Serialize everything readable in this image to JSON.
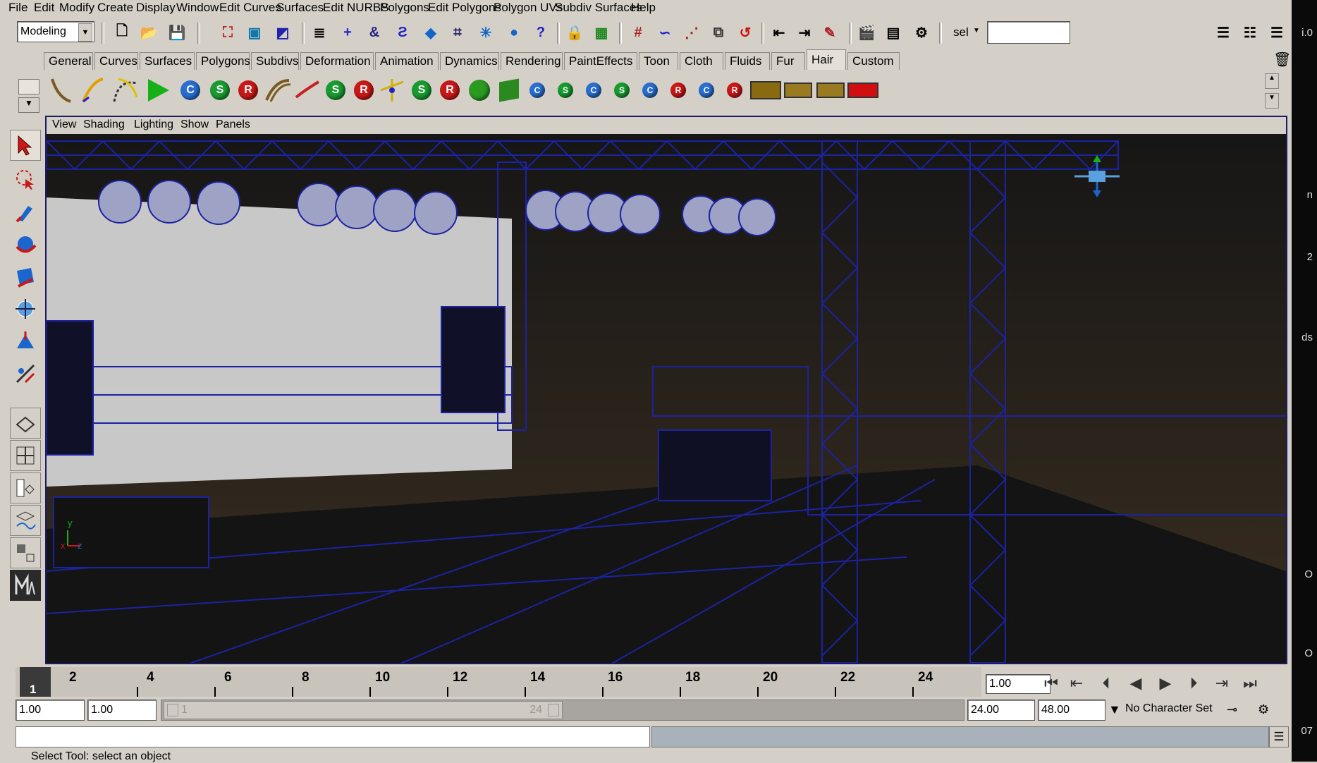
{
  "menu": [
    "File",
    "Edit",
    "Modify",
    "Create",
    "Display",
    "Window",
    "Edit Curves",
    "Surfaces",
    "Edit NURBS",
    "Polygons",
    "Edit Polygons",
    "Polygon UVs",
    "Subdiv Surfaces",
    "Help"
  ],
  "status_line": {
    "mode_select": "Modeling",
    "selection_label": "sel",
    "selection_field": ""
  },
  "shelf_tabs": [
    "General",
    "Curves",
    "Surfaces",
    "Polygons",
    "Subdivs",
    "Deformation",
    "Animation",
    "Dynamics",
    "Rendering",
    "PaintEffects",
    "Toon",
    "Cloth",
    "Fluids",
    "Fur",
    "Hair",
    "Custom"
  ],
  "active_shelf": "Hair",
  "panel_menu": [
    "View",
    "Shading",
    "Lighting",
    "Show",
    "Panels"
  ],
  "timeline": {
    "current_frame_marker": "1",
    "tick_labels": [
      "2",
      "4",
      "6",
      "8",
      "10",
      "12",
      "14",
      "16",
      "18",
      "20",
      "22",
      "24"
    ],
    "current_time": "1.00"
  },
  "range": {
    "start_time": "1.00",
    "playback_start": "1.00",
    "handle_start": "1",
    "handle_end": "24",
    "playback_end": "24.00",
    "end_time": "48.00",
    "character_set": "No Character Set"
  },
  "help_line": "Select Tool: select an object",
  "right_strip": [
    "i.0",
    "n",
    "2",
    "ds",
    "O",
    "O",
    "07"
  ],
  "axis": {
    "x": "x",
    "y": "y",
    "z": "z"
  },
  "shelf_ball_letters": [
    "C",
    "S",
    "R",
    "S",
    "R",
    "S",
    "R",
    "C",
    "S",
    "C",
    "S",
    "C",
    "R",
    "C",
    "R"
  ],
  "colors": {
    "viewport_bg": "#1b1b1b",
    "wire": "#1c22a0",
    "panel": "#d4d0c8",
    "highlight": "#e4e0d8"
  }
}
